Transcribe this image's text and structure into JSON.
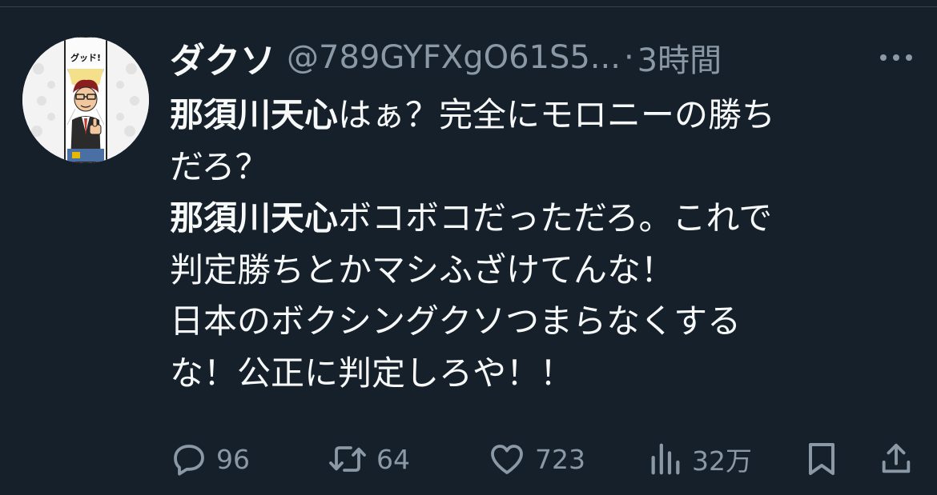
{
  "tweet": {
    "author": {
      "display_name": "ダクソ",
      "handle": "@789GYFXgO61S5...",
      "avatar_caption": "グッド!",
      "avatar_icon": "manga-character-avatar"
    },
    "separator": "·",
    "time": "3時間",
    "more_icon": "more-horizontal-icon",
    "body": {
      "l1_bold": "那須川天心",
      "l1_text": "はぁ？完全にモロニーの勝ち",
      "l2_text": "だろ？",
      "l3_bold": "那須川天心",
      "l3_text": "ボコボコだっただろ。これで",
      "l4_text": "判定勝ちとかマシふざけてんな！",
      "l5_text": "日本のボクシングクソつまらなくする",
      "l6_text": "な！公正に判定しろや！！"
    },
    "actions": {
      "replies": "96",
      "retweets": "64",
      "likes": "723",
      "views": "32万"
    }
  },
  "colors": {
    "background": "#15202b",
    "text_primary": "#f7f9f9",
    "text_secondary": "#8b98a5",
    "divider": "#38444d"
  }
}
